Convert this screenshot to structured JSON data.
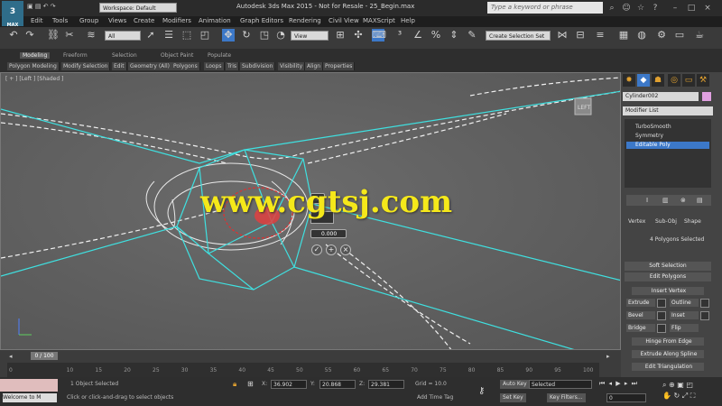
{
  "window": {
    "title": "Autodesk 3ds Max 2015   - Not for Resale -   25_Begin.max",
    "logo_text": "MAX",
    "workspace": "Workspace: Default",
    "search_placeholder": "Type a keyword or phrase"
  },
  "menu": [
    "Edit",
    "Tools",
    "Group",
    "Views",
    "Create",
    "Modifiers",
    "Animation",
    "Graph Editors",
    "Rendering",
    "Civil View",
    "MAXScript",
    "Help"
  ],
  "toolbar": {
    "selection_filter": "All",
    "ref_coord": "View",
    "named_selection": "Create Selection Set"
  },
  "ribbon": {
    "tabs": [
      "Modeling",
      "Freeform",
      "Selection",
      "Object Paint",
      "Populate"
    ],
    "subtabs": [
      "Polygon Modeling",
      "Modify Selection",
      "Edit",
      "Geometry (All)",
      "Polygons",
      "Loops",
      "Tris",
      "Subdivision",
      "Visibility",
      "Align",
      "Properties"
    ]
  },
  "viewport": {
    "label": "[ + ] [Left ] [Shaded ]",
    "caddy_value": "0.000",
    "caddy_button": "Inset",
    "watermark": "www.cgtsj.com"
  },
  "command_panel": {
    "object_name": "Cylinder002",
    "modifier_list": "Modifier List",
    "stack": [
      {
        "name": "TurboSmooth",
        "selected": false
      },
      {
        "name": "Symmetry",
        "selected": false
      },
      {
        "name": "Editable Poly",
        "selected": true
      }
    ],
    "selection_options": [
      "Vertex",
      "Sub-Obj",
      "Shape"
    ],
    "status": "4 Polygons Selected",
    "soft_selection": "Soft Selection",
    "edit_polygons": "Edit Polygons",
    "insert_vertex": "Insert Vertex",
    "extrude": "Extrude",
    "outline": "Outline",
    "bevel": "Bevel",
    "inset": "Inset",
    "bridge": "Bridge",
    "flip": "Flip",
    "hinge": "Hinge From Edge",
    "extrude_spline": "Extrude Along Spline",
    "edit_triangulation": "Edit Triangulation"
  },
  "timeline": {
    "slider": "0 / 100",
    "ticks": [
      "0",
      "10",
      "15",
      "20",
      "25",
      "30",
      "35",
      "40",
      "45",
      "50",
      "55",
      "60",
      "65",
      "70",
      "75",
      "80",
      "85",
      "90",
      "95",
      "100"
    ]
  },
  "status": {
    "maxscript": "Welcome to M",
    "objects": "1 Object Selected",
    "prompt": "Click or click-and-drag to select objects",
    "x": "36.902",
    "y": "20.868",
    "z": "29.381",
    "grid": "Grid = 10.0",
    "autokey": "Auto Key",
    "selected": "Selected",
    "set_key": "Set Key",
    "key_filters": "Key Filters...",
    "add_time_tag": "Add Time Tag",
    "frame": "0"
  },
  "colors": {
    "accent_blue": "#3c78c8",
    "wire_cyan": "#3fe0e0",
    "watermark_yellow": "#f5e81a"
  }
}
